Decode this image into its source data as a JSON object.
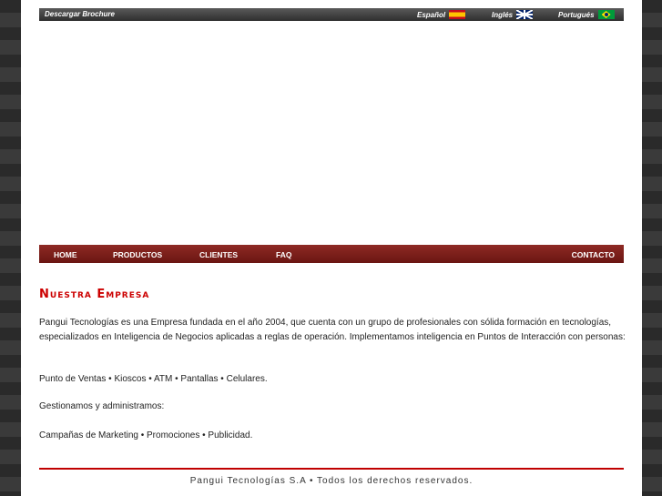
{
  "topbar": {
    "brochure_label": "Descargar Brochure",
    "languages": [
      {
        "label": "Español",
        "flag": "flag-spain-icon"
      },
      {
        "label": "Inglés",
        "flag": "flag-uk-icon"
      },
      {
        "label": "Portugués",
        "flag": "flag-brazil-icon"
      }
    ]
  },
  "nav": {
    "items": [
      "HOME",
      "PRODUCTOS",
      "CLIENTES",
      "FAQ",
      "CONTACTO"
    ]
  },
  "content": {
    "heading": "Nuestra Empresa",
    "paragraphs": [
      "Pangui Tecnologías es una Empresa fundada en el año 2004, que cuenta con un grupo de profesionales con sólida formación en tecnologías, especializados en Inteligencia de Negocios aplicadas a reglas de operación. Implementamos inteligencia en Puntos de Interacción con personas:",
      "Punto de Ventas • Kioscos • ATM • Pantallas • Celulares.",
      "Gestionamos y administramos:",
      "Campañas de Marketing • Promociones • Publicidad."
    ]
  },
  "footer": {
    "text": "Pangui Tecnologías S.A • Todos los derechos reservados."
  },
  "colors": {
    "accent": "#cc0000",
    "nav_bg": "#7a1e19"
  }
}
